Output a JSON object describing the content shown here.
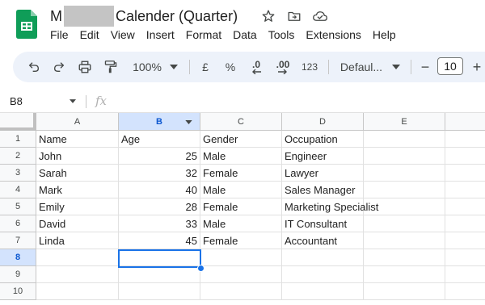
{
  "app": {
    "title_prefix": "M",
    "title_suffix": "Calender (Quarter)",
    "menu": [
      "File",
      "Edit",
      "View",
      "Insert",
      "Format",
      "Data",
      "Tools",
      "Extensions",
      "Help"
    ]
  },
  "toolbar": {
    "zoom": "100%",
    "currency": "£",
    "percent": "%",
    "decrease_decimal": ".0",
    "increase_decimal": ".00",
    "number_format": "123",
    "font": "Defaul...",
    "font_size": "10",
    "minus": "−",
    "plus": "+"
  },
  "formula_bar": {
    "cell_ref": "B8",
    "fx": "fx",
    "value": ""
  },
  "grid": {
    "columns": [
      "A",
      "B",
      "C",
      "D",
      "E"
    ],
    "rows": [
      "1",
      "2",
      "3",
      "4",
      "5",
      "6",
      "7",
      "8",
      "9",
      "10"
    ],
    "selected_cell": "B8",
    "header": [
      "Name",
      "Age",
      "Gender",
      "Occupation"
    ],
    "data": [
      [
        "John",
        "25",
        "Male",
        "Engineer"
      ],
      [
        "Sarah",
        "32",
        "Female",
        "Lawyer"
      ],
      [
        "Mark",
        "40",
        "Male",
        "Sales Manager"
      ],
      [
        "Emily",
        "28",
        "Female",
        "Marketing Specialist"
      ],
      [
        "David",
        "33",
        "Male",
        "IT Consultant"
      ],
      [
        "Linda",
        "45",
        "Female",
        "Accountant"
      ]
    ]
  },
  "colors": {
    "brand": "#0f9d58",
    "selection": "#1a73e8",
    "toolbar_bg": "#edf2fa"
  }
}
